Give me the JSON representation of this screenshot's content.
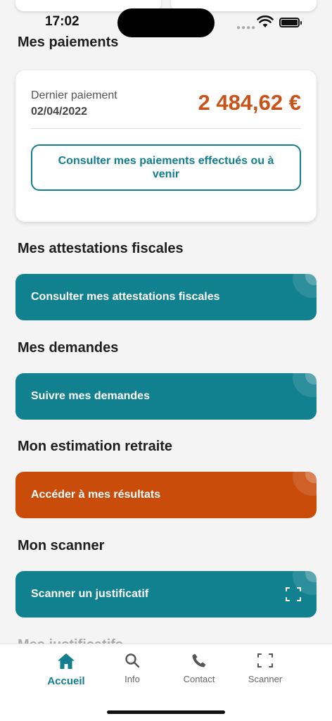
{
  "status_bar": {
    "time": "17:02"
  },
  "payments": {
    "section_title": "Mes paiements",
    "last_payment_label": "Dernier paiement",
    "last_payment_date": "02/04/2022",
    "amount": "2 484,62 €",
    "consult_button": "Consulter mes paiements effectués ou à venir"
  },
  "tax": {
    "section_title": "Mes attestations fiscales",
    "button": "Consulter mes attestations fiscales"
  },
  "requests": {
    "section_title": "Mes demandes",
    "button": "Suivre mes demandes"
  },
  "retirement": {
    "section_title": "Mon estimation retraite",
    "button": "Accéder à mes résultats"
  },
  "scanner": {
    "section_title": "Mon scanner",
    "button": "Scanner un justificatif",
    "icon": "scan-frame-icon"
  },
  "next_section_peek": "Mes justificatifs",
  "tabbar": {
    "tabs": [
      {
        "label": "Accueil",
        "icon": "home-icon",
        "active": true
      },
      {
        "label": "Info",
        "icon": "search-icon",
        "active": false
      },
      {
        "label": "Contact",
        "icon": "phone-icon",
        "active": false
      },
      {
        "label": "Scanner",
        "icon": "scan-frame-icon",
        "active": false
      }
    ]
  },
  "colors": {
    "teal": "#11808f",
    "orange": "#c94c0b",
    "amount": "#c9541a"
  }
}
